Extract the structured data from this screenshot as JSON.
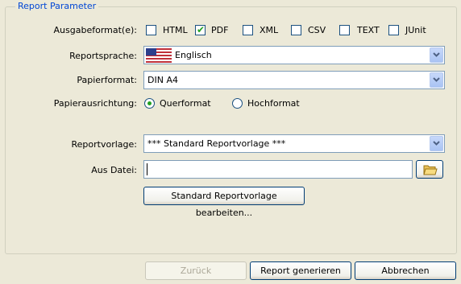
{
  "group": {
    "title": "Report Parameter"
  },
  "format": {
    "label": "Ausgabeformat(e):",
    "options": [
      {
        "label": "HTML",
        "checked": false
      },
      {
        "label": "PDF",
        "checked": true
      },
      {
        "label": "XML",
        "checked": false
      },
      {
        "label": "CSV",
        "checked": false
      },
      {
        "label": "TEXT",
        "checked": false
      },
      {
        "label": "JUnit",
        "checked": false
      }
    ]
  },
  "language": {
    "label": "Reportsprache:",
    "value": "Englisch",
    "flag_icon": "us-flag-icon"
  },
  "paper_format": {
    "label": "Papierformat:",
    "value": "DIN A4"
  },
  "orientation": {
    "label": "Papierausrichtung:",
    "options": [
      {
        "label": "Querformat",
        "selected": true
      },
      {
        "label": "Hochformat",
        "selected": false
      }
    ]
  },
  "template": {
    "label": "Reportvorlage:",
    "value": "*** Standard Reportvorlage ***"
  },
  "file": {
    "label": "Aus Datei:",
    "value": "",
    "browse_icon": "folder-icon"
  },
  "edit_template_button": "Standard Reportvorlage bearbeiten...",
  "footer": {
    "back": "Zurück",
    "generate": "Report generieren",
    "cancel": "Abbrechen"
  },
  "colors": {
    "accent": "#21a121",
    "title": "#0046d5",
    "background": "#ece9d8"
  }
}
